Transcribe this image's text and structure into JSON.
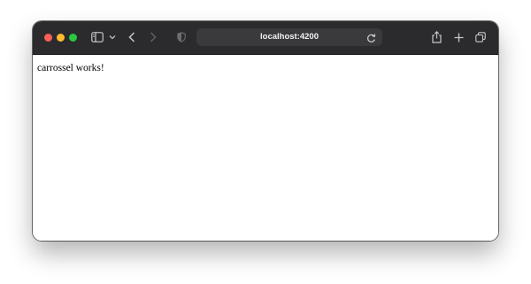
{
  "browser": {
    "address": "localhost:4200",
    "icons": {
      "sidebar": "sidebar-icon",
      "sidebar_menu": "chevron-down-icon",
      "back": "chevron-left-icon",
      "forward": "chevron-right-icon",
      "privacy": "shield-icon",
      "reload": "reload-icon",
      "share": "share-icon",
      "new_tab": "plus-icon",
      "tabs": "tab-overview-icon"
    },
    "colors": {
      "toolbar": "#2b2b2d",
      "address_bar": "#3a3a3c",
      "close": "#fe5f57",
      "minimize": "#febc2e",
      "zoom": "#28c840"
    }
  },
  "page": {
    "text": "carrossel works!"
  }
}
